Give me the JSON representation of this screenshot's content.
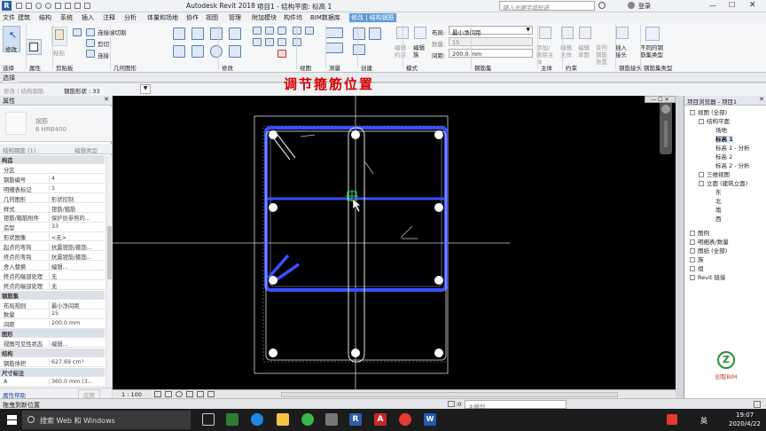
{
  "titlebar": {
    "app_title": "Autodesk Revit 2018 -",
    "doc_title": "项目1 - 结构平面: 标高 1",
    "search_placeholder": "键入关键字或短语",
    "login_label": "登录"
  },
  "menus": [
    "文件",
    "建筑",
    "结构",
    "系统",
    "插入",
    "注释",
    "分析",
    "体量和场地",
    "协作",
    "视图",
    "管理",
    "附加模块",
    "构件坞",
    "BIM数据库",
    "修改 | 结构钢筋"
  ],
  "ribbon": {
    "select_label": "选择",
    "modify_label": "修改",
    "paste_label": "粘贴",
    "connect_label": "连接端切割",
    "cut_label": "剪切",
    "join_label": "连接",
    "layout_label": "布局:",
    "layout_value": "最小净间距",
    "quantity_label": "数量:",
    "quantity_value": "15",
    "spacing_label": "间距:",
    "spacing_value": "200.0 mm",
    "edit_constraints": "编辑约束",
    "edit_family": "编辑族",
    "add_remove_label": "添加/删除主体",
    "edit_host": "编辑主体",
    "edit_shape": "编辑草图",
    "variable_shape": "变的钢筋放置",
    "insert_label": "插入接头",
    "different_rebar": "不同的钢筋集类型",
    "groups": [
      "选择",
      "属性",
      "剪贴板",
      "几何图形",
      "修改",
      "视图",
      "测量",
      "创建",
      "模式",
      "钢筋集",
      "主体",
      "约束",
      "钢筋接头",
      "钢筋集类型"
    ]
  },
  "optbar": {
    "context": "修改 | 结构钢筋",
    "shape_label": "钢筋形状 : 33"
  },
  "overlay_caption": "调节箍筋位置",
  "properties": {
    "header": "属性",
    "family_name": "钢筋",
    "family_type": "6 HRB400",
    "filter_label": "结构钢筋 (1)",
    "edit_type_button": "编辑类型",
    "rows": [
      {
        "k": "构造",
        "v": "",
        "g": true
      },
      {
        "k": "分区",
        "v": ""
      },
      {
        "k": "钢筋编号",
        "v": "4"
      },
      {
        "k": "明细表标记",
        "v": "1"
      },
      {
        "k": "几何图形",
        "v": "形状控制"
      },
      {
        "k": "样式",
        "v": "镫筋/箍筋"
      },
      {
        "k": "镫筋/箍筋附件",
        "v": "保护层参照的..."
      },
      {
        "k": "造型",
        "v": "33"
      },
      {
        "k": "形状图像",
        "v": "<无>"
      },
      {
        "k": "起点的弯钩",
        "v": "抗震镫筋/箍筋..."
      },
      {
        "k": "终点的弯钩",
        "v": "抗震镫筋/箍筋..."
      },
      {
        "k": "舍入替换",
        "v": "编辑..."
      },
      {
        "k": "终点的端部处理",
        "v": "无"
      },
      {
        "k": "终点的端部处理",
        "v": "无"
      },
      {
        "k": "钢筋集",
        "v": "",
        "g": true
      },
      {
        "k": "布局规则",
        "v": "最小净间距"
      },
      {
        "k": "数量",
        "v": "15"
      },
      {
        "k": "间距",
        "v": "200.0 mm"
      },
      {
        "k": "图形",
        "v": "",
        "g": true
      },
      {
        "k": "视图可见性状态",
        "v": "编辑..."
      },
      {
        "k": "结构",
        "v": "",
        "g": true
      },
      {
        "k": "钢筋体积",
        "v": "627.69 cm³"
      },
      {
        "k": "尺寸标注",
        "v": "",
        "g": true
      },
      {
        "k": "A",
        "v": "360.0 mm (3..."
      }
    ],
    "help_link": "属性帮助",
    "apply_button": "应用"
  },
  "browser": {
    "header": "项目浏览器 - 项目1",
    "nodes": [
      {
        "t": "视图 (全部)",
        "d": 0
      },
      {
        "t": "结构平面",
        "d": 1
      },
      {
        "t": "场地",
        "d": 2
      },
      {
        "t": "标高 1",
        "d": 2,
        "sel": true
      },
      {
        "t": "标高 1 - 分析",
        "d": 2
      },
      {
        "t": "标高 2",
        "d": 2
      },
      {
        "t": "标高 2 - 分析",
        "d": 2
      },
      {
        "t": "三维视图",
        "d": 1
      },
      {
        "t": "立面 (建筑立面)",
        "d": 1
      },
      {
        "t": "东",
        "d": 2
      },
      {
        "t": "北",
        "d": 2
      },
      {
        "t": "南",
        "d": 2
      },
      {
        "t": "西",
        "d": 2
      },
      {
        "t": "图例",
        "d": 0
      },
      {
        "t": "明细表/数量",
        "d": 0
      },
      {
        "t": "图纸 (全部)",
        "d": 0
      },
      {
        "t": "族",
        "d": 0
      },
      {
        "t": "组",
        "d": 0
      },
      {
        "t": "Revit 链接",
        "d": 0
      }
    ],
    "logo_text": "创智BIM"
  },
  "viewbar": {
    "scale": "1 : 100"
  },
  "status": {
    "message": "拖曳到新位置",
    "model_label": "主模型",
    "zero": ":0"
  },
  "taskbar": {
    "search_text": "搜索 Web 和 Windows",
    "time": "19:07",
    "date": "2020/4/22",
    "lang": "英"
  },
  "colors": {
    "rebar_highlight": "#3a4fff",
    "accent": "#5b9bd5",
    "caption": "#d40000"
  }
}
